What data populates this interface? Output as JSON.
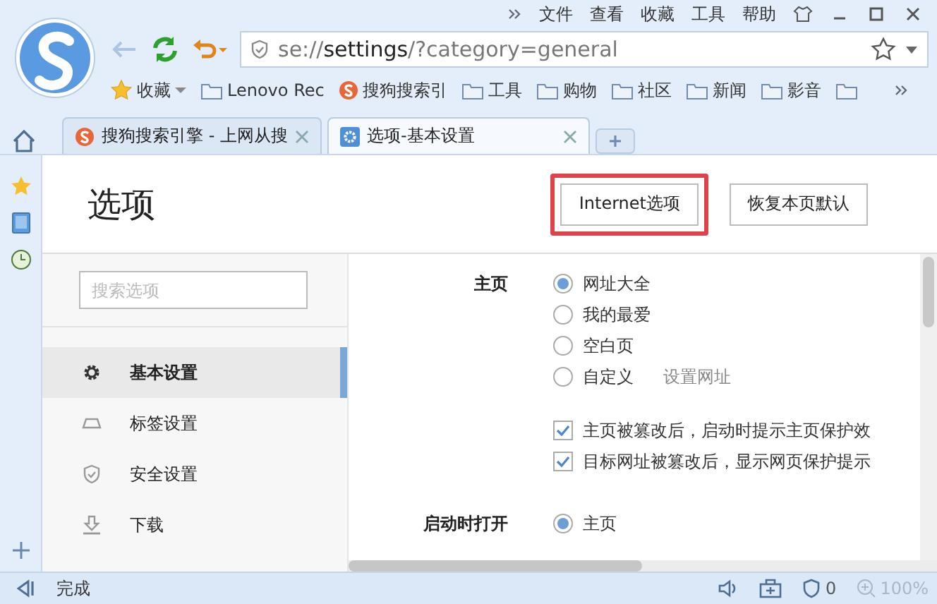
{
  "menu": [
    "文件",
    "查看",
    "收藏",
    "工具",
    "帮助"
  ],
  "address": {
    "value": "se://**settings**/?category=general"
  },
  "bookmarks": [
    {
      "kind": "favorites",
      "label": "收藏"
    },
    {
      "kind": "folder",
      "label": "Lenovo Rec"
    },
    {
      "kind": "site",
      "label": "搜狗搜索引"
    },
    {
      "kind": "folder",
      "label": "工具"
    },
    {
      "kind": "folder",
      "label": "购物"
    },
    {
      "kind": "folder",
      "label": "社区"
    },
    {
      "kind": "folder",
      "label": "新闻"
    },
    {
      "kind": "folder",
      "label": "影音"
    },
    {
      "kind": "folder"
    }
  ],
  "tabs": [
    {
      "kind": "site",
      "label": "搜狗搜索引擎 - 上网从搜",
      "selected": false
    },
    {
      "kind": "settings",
      "label": "选项-基本设置",
      "selected": true
    }
  ],
  "page": {
    "title": "选项",
    "buttons": [
      {
        "label": "Internet选项",
        "highlighted": true
      },
      {
        "label": "恢复本页默认",
        "highlighted": false
      }
    ]
  },
  "search": {
    "placeholder": "搜索选项"
  },
  "nav": [
    {
      "kind": "gear",
      "label": "基本设置",
      "selected": true
    },
    {
      "kind": "tab",
      "label": "标签设置",
      "selected": false
    },
    {
      "kind": "shield",
      "label": "安全设置",
      "selected": false
    },
    {
      "kind": "download",
      "label": "下载",
      "selected": false
    }
  ],
  "settings": [
    {
      "label": "主页",
      "options": [
        {
          "kind": "radio",
          "label": "网址大全",
          "selected": true
        },
        {
          "kind": "radio",
          "label": "我的最爱",
          "selected": false
        },
        {
          "kind": "radio",
          "label": "空白页",
          "selected": false
        },
        {
          "kind": "radio",
          "label": "自定义",
          "selected": false,
          "link": "设置网址"
        },
        {
          "kind": "checkbox",
          "label": "主页被篡改后，启动时提示主页保护效",
          "checked": true
        },
        {
          "kind": "checkbox",
          "label": "目标网址被篡改后，显示网页保护提示",
          "checked": true
        }
      ]
    },
    {
      "label": "启动时打开",
      "options": [
        {
          "kind": "radio",
          "label": "主页",
          "selected": true
        }
      ]
    }
  ],
  "status_bar": {
    "text": "完成",
    "blocked_count": "0",
    "zoom": "100%"
  }
}
